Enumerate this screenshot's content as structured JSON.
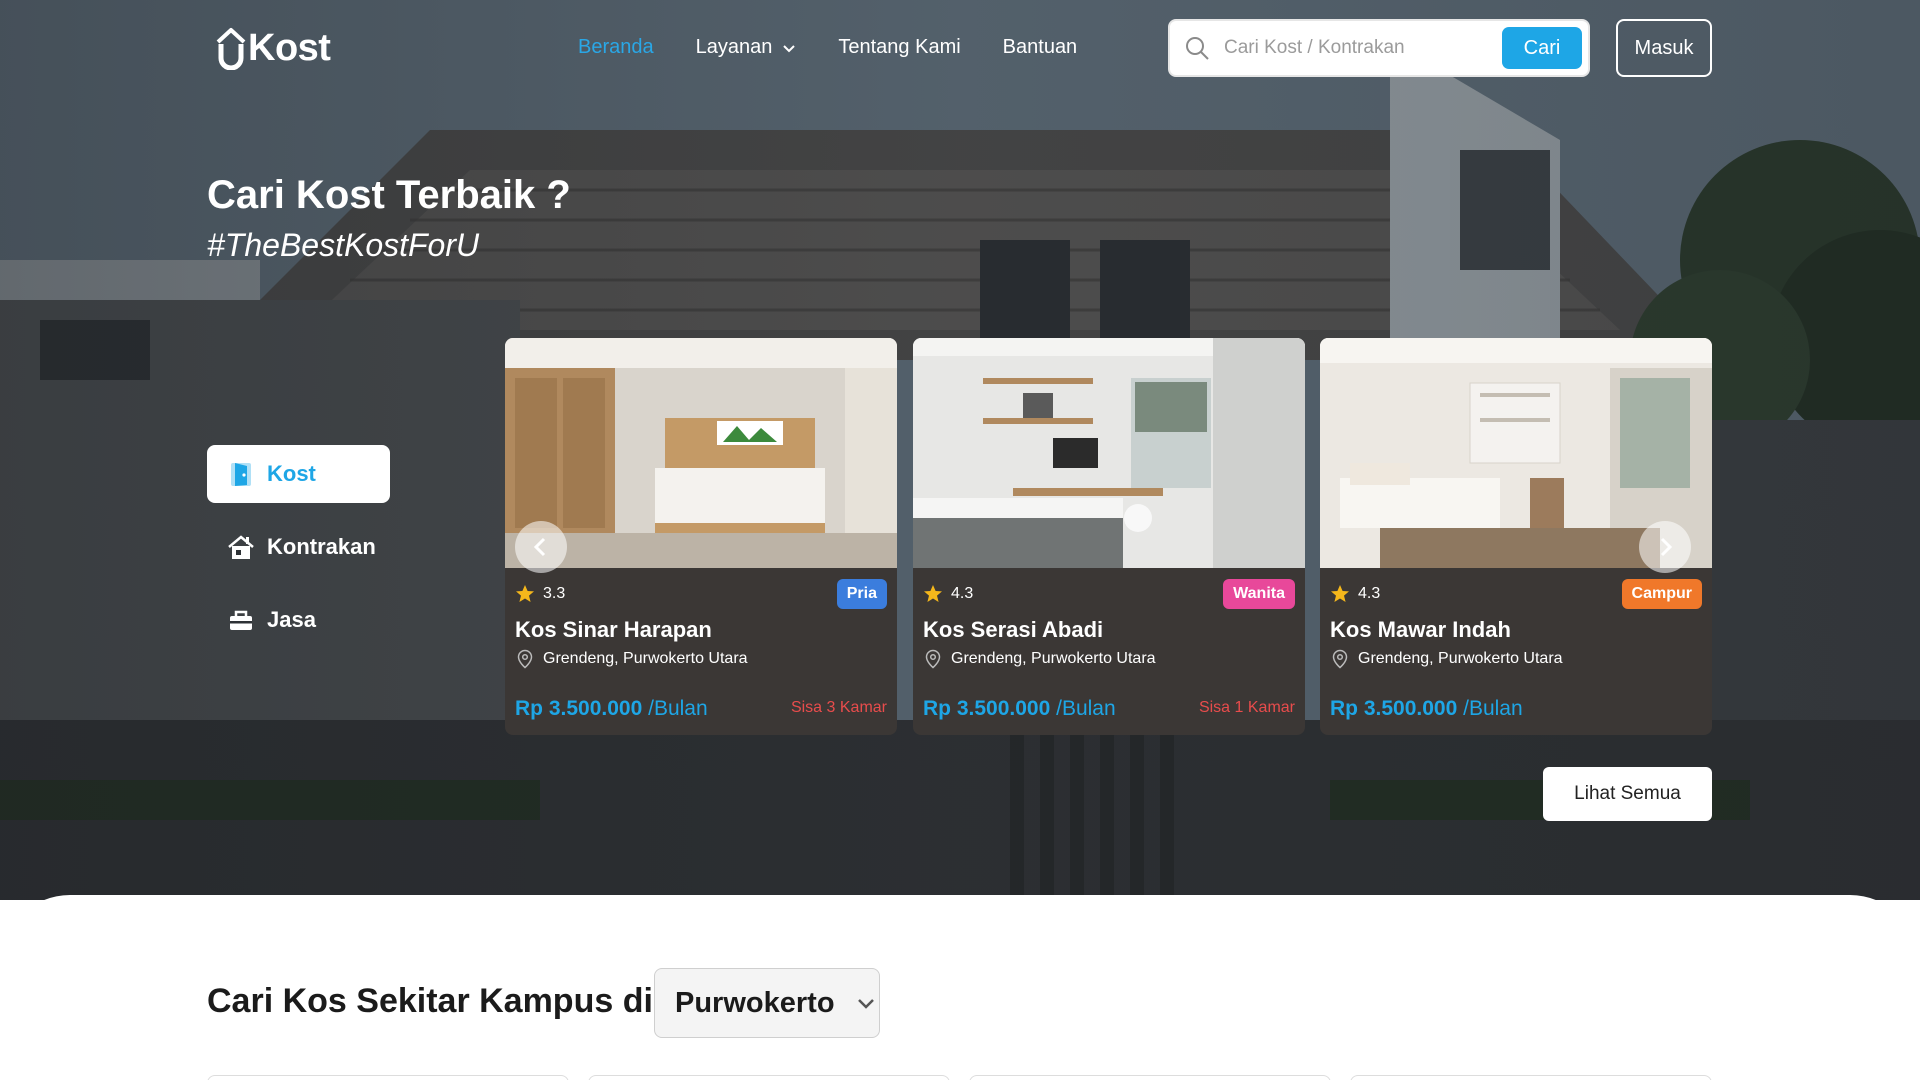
{
  "brand": {
    "logo_text": "Kost",
    "logo_mark": "U"
  },
  "nav": {
    "items": [
      {
        "label": "Beranda",
        "active": true
      },
      {
        "label": "Layanan",
        "has_dropdown": true
      },
      {
        "label": "Tentang Kami"
      },
      {
        "label": "Bantuan"
      }
    ]
  },
  "search": {
    "placeholder": "Cari Kost / Kontrakan",
    "value": "",
    "button_label": "Cari"
  },
  "login_label": "Masuk",
  "hero": {
    "title": "Cari Kost Terbaik ?",
    "tagline": "#TheBestKostForU"
  },
  "categories": [
    {
      "label": "Kost",
      "icon": "door-icon",
      "active": true
    },
    {
      "label": "Kontrakan",
      "icon": "house-icon"
    },
    {
      "label": "Jasa",
      "icon": "toolbox-icon"
    }
  ],
  "listings": [
    {
      "rating": "3.3",
      "gender": "Pria",
      "gender_color": "#3b7ddd",
      "name": "Kos Sinar Harapan",
      "location": "Grendeng, Purwokerto Utara",
      "price": "Rp 3.500.000",
      "period": "/Bulan",
      "remaining": "Sisa 3 Kamar"
    },
    {
      "rating": "4.3",
      "gender": "Wanita",
      "gender_color": "#e8489a",
      "name": "Kos Serasi Abadi",
      "location": "Grendeng, Purwokerto Utara",
      "price": "Rp 3.500.000",
      "period": "/Bulan",
      "remaining": "Sisa 1 Kamar"
    },
    {
      "rating": "4.3",
      "gender": "Campur",
      "gender_color": "#f0782a",
      "name": "Kos Mawar Indah",
      "location": "Grendeng, Purwokerto Utara",
      "price": "Rp 3.500.000",
      "period": "/Bulan",
      "remaining": ""
    }
  ],
  "see_all_label": "Lihat Semua",
  "campus_section": {
    "title": "Cari Kos Sekitar Kampus di",
    "city": "Purwokerto"
  },
  "colors": {
    "accent": "#1ea6e6",
    "danger": "#e84c4c",
    "star": "#f5b71b",
    "card_bg": "#3b3735"
  }
}
